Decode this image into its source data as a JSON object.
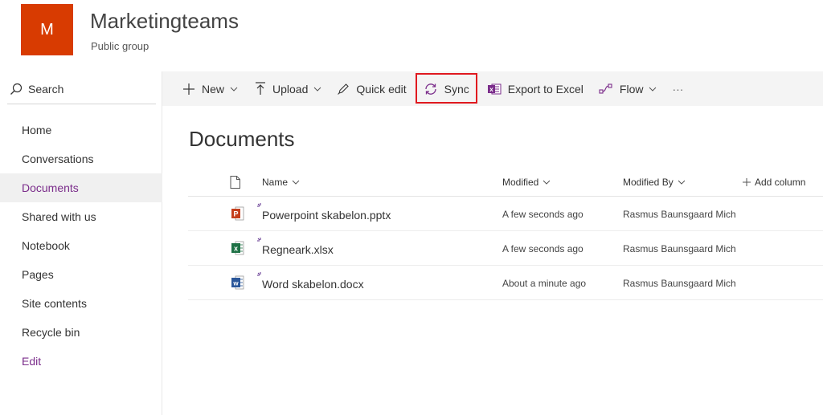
{
  "header": {
    "logo_letter": "M",
    "site_title": "Marketingteams",
    "site_subtitle": "Public group",
    "logo_color": "#d83b01"
  },
  "nav": {
    "search_label": "Search",
    "items": [
      {
        "label": "Home"
      },
      {
        "label": "Conversations"
      },
      {
        "label": "Documents",
        "active": true
      },
      {
        "label": "Shared with us"
      },
      {
        "label": "Notebook"
      },
      {
        "label": "Pages"
      },
      {
        "label": "Site contents"
      },
      {
        "label": "Recycle bin"
      },
      {
        "label": "Edit"
      }
    ]
  },
  "commands": {
    "new": "New",
    "upload": "Upload",
    "quick_edit": "Quick edit",
    "sync": "Sync",
    "export": "Export to Excel",
    "flow": "Flow",
    "more": "···"
  },
  "library": {
    "title": "Documents",
    "columns": {
      "name": "Name",
      "modified": "Modified",
      "modified_by": "Modified By",
      "add_column": "Add column"
    },
    "files": [
      {
        "name": "Powerpoint skabelon.pptx",
        "type": "pptx-icon",
        "modified": "A few seconds ago",
        "modified_by": "Rasmus Baunsgaard Miche"
      },
      {
        "name": "Regneark.xlsx",
        "type": "xlsx-icon",
        "modified": "A few seconds ago",
        "modified_by": "Rasmus Baunsgaard Miche"
      },
      {
        "name": "Word skabelon.docx",
        "type": "docx-icon",
        "modified": "About a minute ago",
        "modified_by": "Rasmus Baunsgaard Miche"
      }
    ]
  },
  "colors": {
    "accent": "#7b2d8b",
    "highlight": "#e0191f",
    "command_bar_bg": "#f4f4f4"
  }
}
